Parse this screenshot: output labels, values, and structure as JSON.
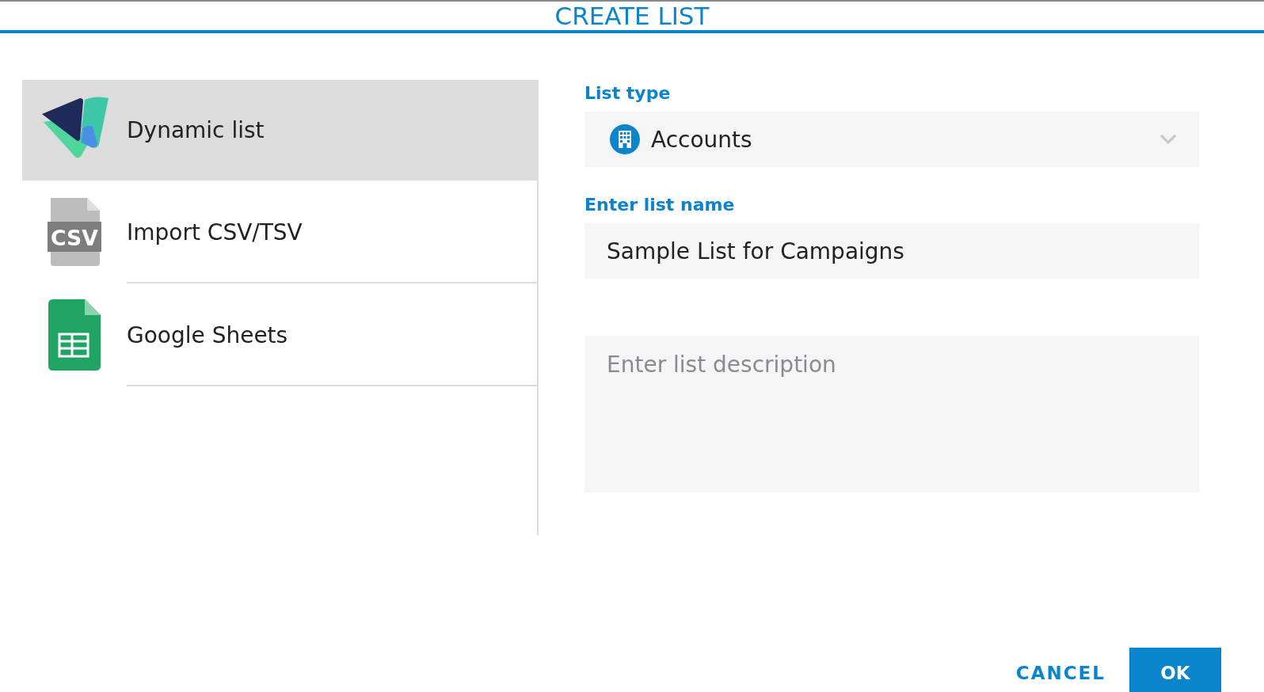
{
  "dialog": {
    "title": "CREATE LIST"
  },
  "sources": [
    {
      "kind": "dynamic",
      "label": "Dynamic list",
      "selected": true
    },
    {
      "kind": "csv",
      "label": "Import CSV/TSV",
      "icon_text": "CSV",
      "selected": false
    },
    {
      "kind": "sheets",
      "label": "Google Sheets",
      "selected": false
    }
  ],
  "list_type": {
    "label": "List type",
    "value": "Accounts"
  },
  "list_name": {
    "label": "Enter list name",
    "value": "Sample List for Campaigns"
  },
  "description": {
    "placeholder": "Enter list description"
  },
  "buttons": [
    {
      "kind": "flat",
      "label": "CANCEL"
    },
    {
      "kind": "primary",
      "label": "OK"
    }
  ]
}
